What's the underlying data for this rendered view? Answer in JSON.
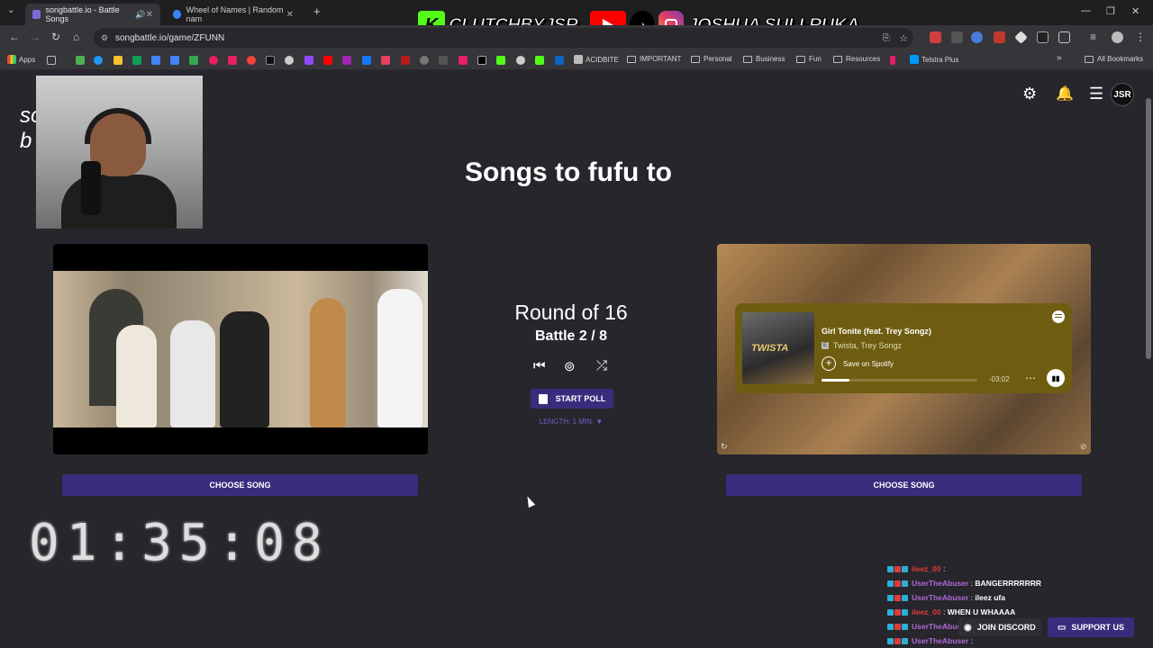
{
  "browser": {
    "tabs": [
      {
        "label": "songbattle.io - Battle Songs",
        "active": true,
        "favicon_color": "#7c6bd6"
      },
      {
        "label": "Wheel of Names | Random nam",
        "active": false,
        "favicon_color": "#3b82f6"
      }
    ],
    "url": "songbattle.io/game/ZFUNN",
    "bookmarks": {
      "apps_label": "Apps",
      "items": [
        "ACIDBITE",
        "IMPORTANT",
        "Personal",
        "Business",
        "Fun",
        "Resources",
        "Telstra Plus"
      ],
      "all_bookmarks_label": "All Bookmarks"
    }
  },
  "overlay": {
    "kick_name": "CLUTCHBYJSR",
    "social_name": "JOSHUA SULI-RUKA"
  },
  "page": {
    "logo_partial": "so\nb",
    "title": "Songs to fufu to",
    "avatar_text": "JSR",
    "round": "Round of 16",
    "battle": "Battle 2 / 8",
    "start_poll_label": "START POLL",
    "length_label": "LENGTH: 1 MIN. ▼",
    "choose_left_label": "CHOOSE SONG",
    "choose_right_label": "CHOOSE SONG",
    "timer": "01:35:08",
    "support_label": "SUPPORT US",
    "discord_label": "JOIN DISCORD"
  },
  "spotify": {
    "track": "Girl Tonite (feat. Trey Songz)",
    "explicit": "E",
    "artists": "Twista, Trey Songz",
    "save_label": "Save on Spotify",
    "time_remaining": "-03:02",
    "progress": 0.18,
    "album_text": "TWISTA"
  },
  "chat": [
    {
      "user": "ileez_00",
      "msg": "",
      "user_color": "#e03a3a"
    },
    {
      "user": "UserTheAbuser",
      "msg": "BANGERRRRRRR",
      "user_color": "#b06ad8"
    },
    {
      "user": "UserTheAbuser",
      "msg": "ileez ufa",
      "user_color": "#b06ad8"
    },
    {
      "user": "ileez_00",
      "msg": "WHEN U WHAAAA",
      "user_color": "#e03a3a"
    },
    {
      "user": "UserTheAbuser",
      "msg": "",
      "user_color": "#b06ad8"
    },
    {
      "user": "UserTheAbuser",
      "msg": "",
      "user_color": "#b06ad8"
    }
  ],
  "colors": {
    "accent": "#3a2c7d",
    "background": "#26262c",
    "spotify_card": "#6e5d10"
  }
}
